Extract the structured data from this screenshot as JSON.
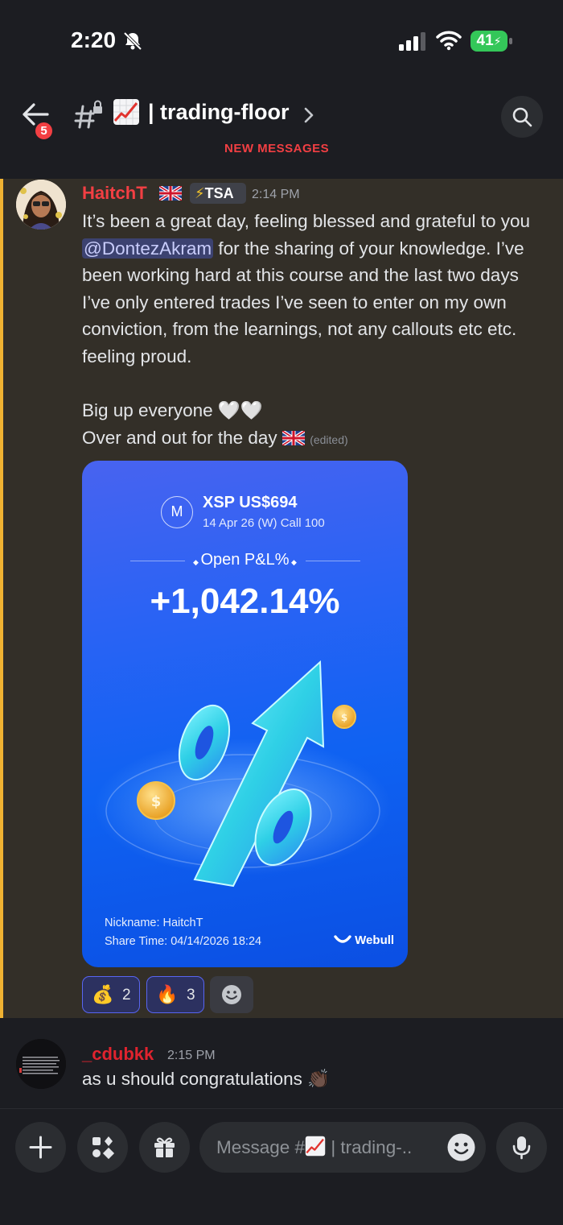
{
  "status_bar": {
    "time": "2:20",
    "battery": "41"
  },
  "header": {
    "badge_count": "5",
    "channel_name": "| trading-floor",
    "channel_emoji": "chart-increasing-icon"
  },
  "divider": {
    "label": "NEW MESSAGES"
  },
  "message1": {
    "author": "HaitchT",
    "tag": "TSA",
    "timestamp": "2:14 PM",
    "text_before_mention": "It’s been a great day, feeling blessed and grateful to you ",
    "mention": "@DontezAkram",
    "text_after_mention": " for the sharing of your knowledge. I’ve been working hard at this course and the last two days I’ve only entered trades I’ve seen to enter on my own conviction, from the learnings, not any callouts etc etc. feeling proud.",
    "line2": "Big up everyone 🤍🤍",
    "line3": "Over and out for the day",
    "edited": "(edited)"
  },
  "card": {
    "icon_letter": "M",
    "ticker": "XSP US$694",
    "contract": "14 Apr 26 (W) Call 100",
    "pl_label": "Open P&L%",
    "pl_value": "+1,042.14%",
    "nickname": "Nickname: HaitchT",
    "share_time": "Share Time: 04/14/2026 18:24",
    "brand": "Webull"
  },
  "reactions": [
    {
      "emoji": "💰",
      "count": "2"
    },
    {
      "emoji": "🔥",
      "count": "3"
    }
  ],
  "message2": {
    "author": "_cdubkk",
    "timestamp": "2:15 PM",
    "text": "as u should congratulations 👏🏿"
  },
  "composer": {
    "placeholder_prefix": "Message #",
    "placeholder_suffix": " | trading-.."
  },
  "colors": {
    "accent_red": "#f23f43",
    "highlight_bar": "#f0b232",
    "card_blue": "#0f62f2",
    "mention_bg": "#3c4270"
  }
}
